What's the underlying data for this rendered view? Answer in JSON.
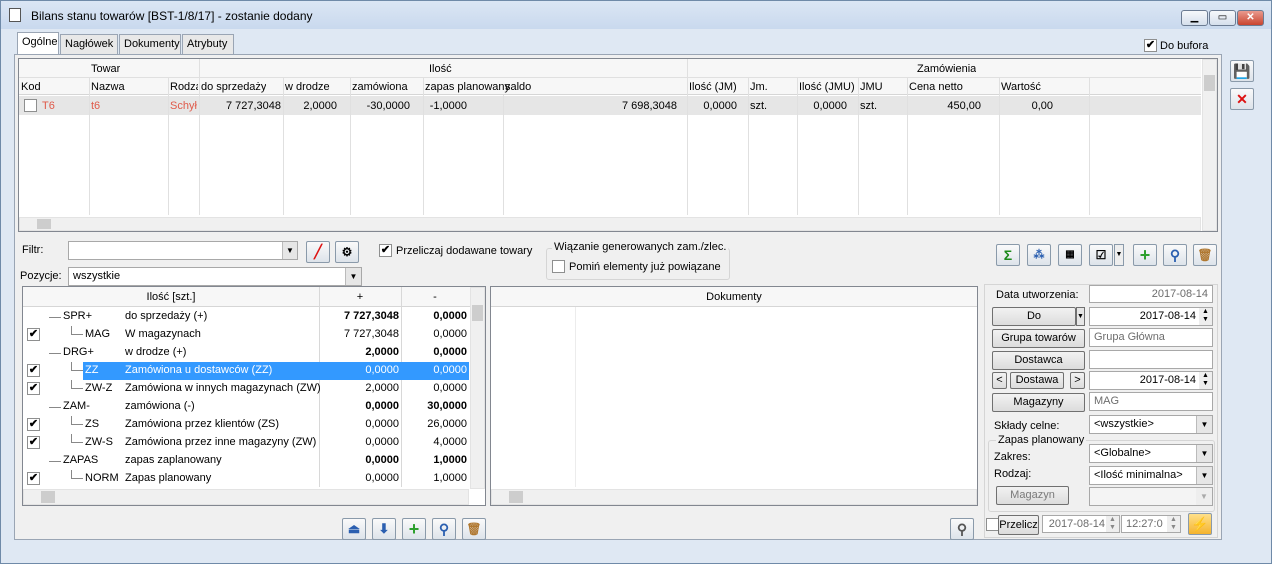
{
  "window": {
    "title": "Bilans stanu towarów [BST-1/8/17] - zostanie dodany",
    "buttons": [
      "▁",
      "▭",
      "✕"
    ]
  },
  "tabs": [
    "Ogólne",
    "Nagłówek",
    "Dokumenty",
    "Atrybuty"
  ],
  "do_bufora": "Do bufora",
  "top_grid": {
    "groups": [
      "Towar",
      "Ilość",
      "Zamówienia"
    ],
    "columns": [
      "Kod",
      "Nazwa",
      "Rodza",
      "do sprzedaży",
      "w drodze",
      "zamówiona",
      "zapas planowany",
      "saldo",
      "Ilość (JM)",
      "Jm.",
      "Ilość (JMU)",
      "JMU",
      "Cena netto",
      "Wartość"
    ],
    "row": {
      "kod": "T6",
      "nazwa": "t6",
      "rodzaj": "Schył",
      "do_sprzedazy": "7 727,3048",
      "w_drodze": "2,0000",
      "zamowiona": "-30,0000",
      "zapas": "-1,0000",
      "saldo": "7 698,3048",
      "ilosc_jm": "0,0000",
      "jm": "szt.",
      "ilosc_jmu": "0,0000",
      "jmu": "szt.",
      "cena": "450,00",
      "wartosc": "0,00"
    }
  },
  "filter": {
    "label": "Filtr:",
    "value": "",
    "przeliczaj": "Przeliczaj dodawane towary",
    "wiazanie_title": "Wiązanie generowanych zam./zlec.",
    "pomin": "Pomiń elementy już powiązane",
    "pozycje_label": "Pozycje:",
    "pozycje_value": "wszystkie"
  },
  "tree": {
    "headers": [
      "Ilość [szt.]",
      "+",
      "-"
    ],
    "rows": [
      {
        "code": "SPR+",
        "name": "do sprzedaży (+)",
        "plus": "7 727,3048",
        "minus": "0,0000",
        "bold": true,
        "check": false,
        "indent": 0
      },
      {
        "code": "MAG",
        "name": "W magazynach",
        "plus": "7 727,3048",
        "minus": "0,0000",
        "bold": false,
        "check": true,
        "indent": 1
      },
      {
        "code": "DRG+",
        "name": "w drodze (+)",
        "plus": "2,0000",
        "minus": "0,0000",
        "bold": true,
        "check": false,
        "indent": 0
      },
      {
        "code": "ZZ",
        "name": "Zamówiona u dostawców (ZZ)",
        "plus": "0,0000",
        "minus": "0,0000",
        "bold": false,
        "check": true,
        "indent": 1,
        "selected": true
      },
      {
        "code": "ZW-Z",
        "name": "Zamówiona w innych magazynach (ZW)",
        "plus": "2,0000",
        "minus": "0,0000",
        "bold": false,
        "check": true,
        "indent": 1
      },
      {
        "code": "ZAM-",
        "name": "zamówiona (-)",
        "plus": "0,0000",
        "minus": "30,0000",
        "bold": true,
        "check": false,
        "indent": 0
      },
      {
        "code": "ZS",
        "name": "Zamówiona przez klientów (ZS)",
        "plus": "0,0000",
        "minus": "26,0000",
        "bold": false,
        "check": true,
        "indent": 1
      },
      {
        "code": "ZW-S",
        "name": "Zamówiona przez inne magazyny (ZW)",
        "plus": "0,0000",
        "minus": "4,0000",
        "bold": false,
        "check": true,
        "indent": 1
      },
      {
        "code": "ZAPAS",
        "name": "zapas zaplanowany",
        "plus": "0,0000",
        "minus": "1,0000",
        "bold": true,
        "check": false,
        "indent": 0
      },
      {
        "code": "NORM",
        "name": "Zapas planowany",
        "plus": "0,0000",
        "minus": "1,0000",
        "bold": false,
        "check": true,
        "indent": 1
      }
    ]
  },
  "dokumenty": {
    "header": "Dokumenty"
  },
  "right": {
    "data_utworzenia_label": "Data utworzenia:",
    "data_utworzenia": "2017-08-14",
    "do_btn": "Do",
    "do_date": "2017-08-14",
    "grupa_btn": "Grupa towarów",
    "grupa_value": "Grupa Główna",
    "dostawca_btn": "Dostawca",
    "dostawca_value": "",
    "dostawa_btn": "Dostawa",
    "dostawa_date": "2017-08-14",
    "magazyny_btn": "Magazyny",
    "magazyny_value": "MAG",
    "sklady_label": "Składy celne:",
    "sklady_value": "<wszystkie>",
    "zapas_title": "Zapas planowany",
    "zakres_label": "Zakres:",
    "zakres_value": "<Globalne>",
    "rodzaj_label": "Rodzaj:",
    "rodzaj_value": "<Ilość minimalna>",
    "magazyn_btn": "Magazyn",
    "magazyn_value": "",
    "przelicz": "Przelicz",
    "przelicz_date": "2017-08-14",
    "przelicz_time": "12:27:0"
  },
  "icons": {
    "sigma": "Σ",
    "plus": "+",
    "search": "⚲",
    "trash": "🗑",
    "save": "💾",
    "close": "✕",
    "up": "⏏",
    "down": "⬇",
    "bolt": "⚡"
  }
}
